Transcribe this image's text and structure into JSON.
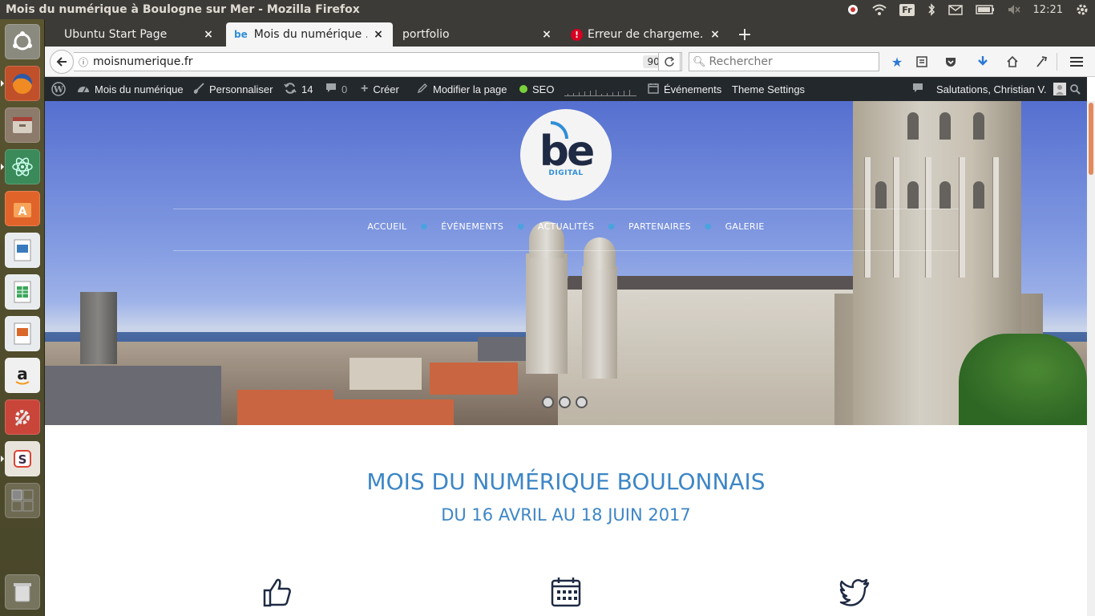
{
  "os_panel": {
    "window_title": "Mois du numérique à Boulogne sur Mer - Mozilla Firefox",
    "keyboard_layout": "Fr",
    "clock": "12:21",
    "indicator_icons": [
      "dropbox-icon",
      "wifi-icon",
      "keyboard-icon",
      "bluetooth-icon",
      "mail-icon",
      "battery-icon",
      "volume-mute-icon",
      "clock",
      "gear-icon"
    ]
  },
  "launcher": {
    "items": [
      "ubuntu-dash-icon",
      "firefox-icon",
      "files-icon",
      "atom-icon",
      "software-center-icon",
      "libreoffice-draw-icon",
      "libreoffice-calc-icon",
      "libreoffice-impress-icon",
      "amazon-icon",
      "system-settings-icon",
      "slack-icon",
      "workspace-switcher-icon",
      "trash-icon"
    ]
  },
  "browser": {
    "tabs": [
      {
        "label": "Ubuntu Start Page",
        "active": false
      },
      {
        "label": "Mois du numérique ...",
        "active": true
      },
      {
        "label": "portfolio",
        "active": false
      },
      {
        "label": "Erreur de chargeme...",
        "active": false
      }
    ],
    "url": "moisnumerique.fr",
    "zoom": "90 %",
    "search_placeholder": "Rechercher"
  },
  "admin_bar": {
    "site_name": "Mois du numérique",
    "customize": "Personnaliser",
    "updates_count": "14",
    "comments_count": "0",
    "new": "Créer",
    "edit_page": "Modifier la page",
    "seo": "SEO",
    "events": "Événements",
    "theme_settings": "Theme Settings",
    "greeting": "Salutations, Christian V."
  },
  "site": {
    "logo_text": "be",
    "logo_subtext": "DIGITAL",
    "nav": [
      "ACCUEIL",
      "ÉVÉNEMENTS",
      "ACTUALITÉS",
      "PARTENAIRES",
      "GALERIE"
    ],
    "slider_dots": 3,
    "heading": "MOIS DU NUMÉRIQUE BOULONNAIS",
    "subheading": "DU 16 AVRIL AU 18 JUIN 2017",
    "features": [
      "thumbs-up-icon",
      "calendar-icon",
      "twitter-icon"
    ]
  },
  "colors": {
    "accent_blue": "#3d86c6",
    "admin_bar": "#23282d",
    "seo_green": "#7ad03a",
    "ubuntu_panel": "#3c3b37"
  }
}
